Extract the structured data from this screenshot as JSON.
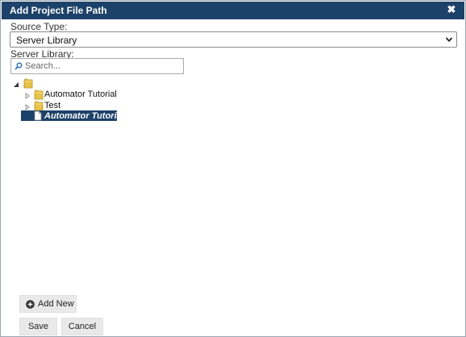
{
  "dialog": {
    "title": "Add Project File Path",
    "close_icon": "close-icon"
  },
  "source_type": {
    "label": "Source Type:",
    "selected": "Server Library"
  },
  "server_library": {
    "label": "Server Library:",
    "search_placeholder": "Search..."
  },
  "tree": {
    "children": [
      {
        "label": "Automator Tutorial",
        "icon": "folder-icon",
        "expanded": false
      },
      {
        "label": "Test",
        "icon": "folder-icon",
        "expanded": false
      },
      {
        "label": "Automator Tutorial",
        "icon": "file-icon",
        "selected": true
      }
    ]
  },
  "buttons": {
    "add_new": "Add New",
    "save": "Save",
    "cancel": "Cancel"
  },
  "colors": {
    "titlebar": "#1d4269",
    "selection": "#1d4269",
    "folder": "#e8c24a"
  }
}
